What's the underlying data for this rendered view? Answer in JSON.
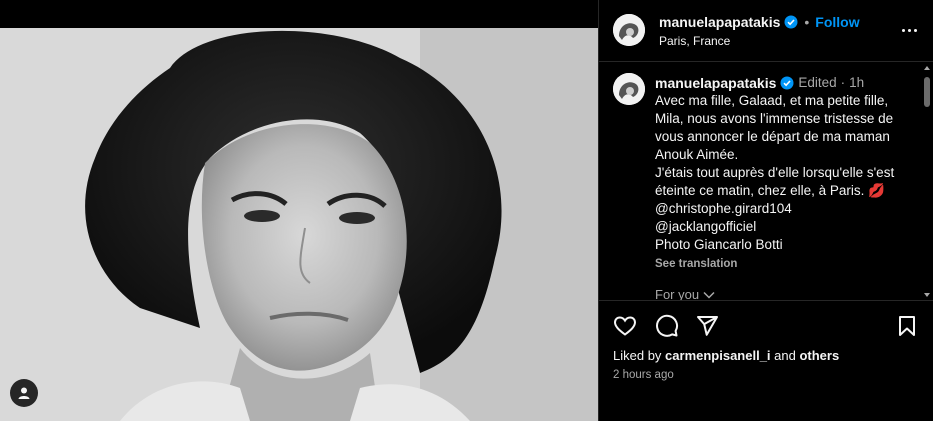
{
  "post": {
    "username": "manuelapapatakis",
    "location": "Paris, France",
    "follow_label": "Follow",
    "separator": "•",
    "accent_color": "#0095f6"
  },
  "caption": {
    "username": "manuelapapatakis",
    "edited": "Edited",
    "separator": "·",
    "time": "1h",
    "lines": [
      "Avec ma fille, Galaad, et ma petite fille,",
      "Mila, nous avons l'immense tristesse de",
      "vous annoncer le départ de ma maman",
      "Anouk Aimée.",
      "J'étais tout auprès d'elle lorsqu'elle s'est",
      "éteinte ce matin, chez elle, à Paris. 💋",
      "@christophe.girard104",
      "@jacklangofficiel",
      "Photo Giancarlo Botti"
    ],
    "see_translation": "See translation"
  },
  "for_you": {
    "label": "For you"
  },
  "likes": {
    "prefix": "Liked by ",
    "user": "carmenpisanell_i",
    "middle": " and ",
    "others": "others"
  },
  "posted_ago": "2 hours ago",
  "icons": {
    "like": "heart-icon",
    "comment": "comment-icon",
    "share": "send-icon",
    "save": "bookmark-icon",
    "more": "more-options-icon",
    "tag": "user-tag-icon",
    "verified": "verified-badge-icon"
  }
}
